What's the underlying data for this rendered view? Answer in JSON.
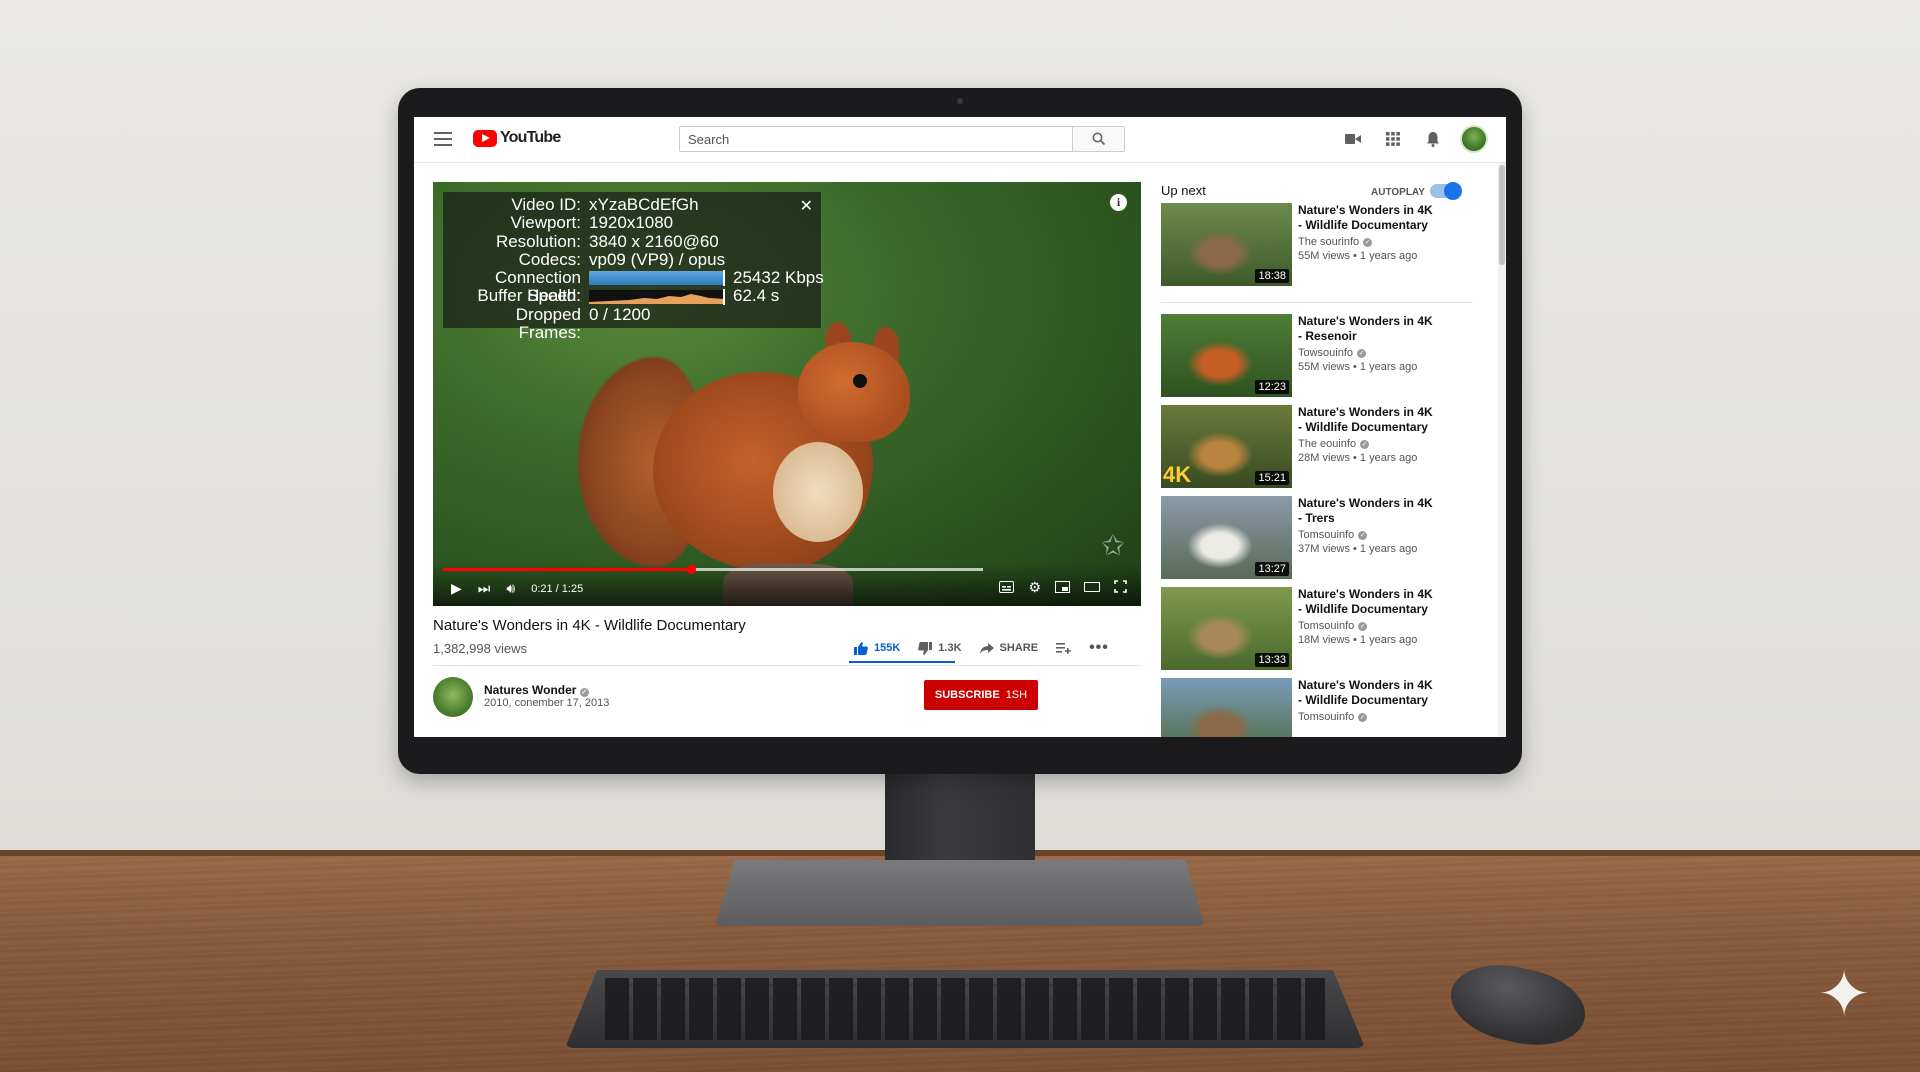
{
  "header": {
    "logo_text": "YouTube",
    "search_placeholder": "Search",
    "icons": [
      "menu-icon",
      "search-icon",
      "video-camera-icon",
      "apps-grid-icon",
      "bell-icon",
      "avatar"
    ]
  },
  "player": {
    "stats": [
      {
        "key": "Video ID:",
        "value": "xYzaBCdEfGh"
      },
      {
        "key": "Viewport:",
        "value": "1920x1080"
      },
      {
        "key": "Resolution:",
        "value": "3840 x 2160@60"
      },
      {
        "key": "Codecs:",
        "value": "vp09 (VP9) / opus"
      },
      {
        "key": "Connection Speed:",
        "value": "25432 Kbps"
      },
      {
        "key": "Buffer Health:",
        "value": "62.4 s"
      },
      {
        "key": "Dropped Frames:",
        "value": "0 / 1200"
      }
    ],
    "time": "0:21 / 1:25",
    "progress_played_fraction": 0.46,
    "progress_buffered_fraction": 1.0,
    "close_symbol": "✕",
    "info_symbol": "i"
  },
  "video": {
    "title": "Nature's Wonders in 4K - Wildlife Documentary",
    "views": "1,382,998 views",
    "like_count": "155K",
    "dislike_count": "1.3K",
    "share_label": "SHARE"
  },
  "channel": {
    "name": "Natures Wonder",
    "date": "2010, conember 17, 2013",
    "subscribe_label": "SUBSCRIBE",
    "subscribe_count": "1SH"
  },
  "sidebar": {
    "up_next_label": "Up next",
    "autoplay_label": "AUTOPLAY",
    "autoplay_on": true,
    "items": [
      {
        "title": "Nature's Wonders in 4K - Wildlife Documentary",
        "channel": "The sourinfo",
        "stats": "55M views • 1 years ago",
        "duration": "18:38",
        "colors": [
          "#6d8a4b",
          "#8a6a48",
          "#3e5a2c"
        ]
      },
      {
        "title": "Nature's Wonders in 4K - Resenoir",
        "channel": "Towsouinfo",
        "stats": "55M views • 1 years ago",
        "duration": "12:23",
        "colors": [
          "#4f7d35",
          "#c65e25",
          "#2e5220"
        ]
      },
      {
        "title": "Nature's Wonders in 4K - Wildlife Documentary",
        "channel": "The eouinfo",
        "stats": "28M views • 1 years ago",
        "duration": "15:21",
        "colors": [
          "#6a7a3a",
          "#b8843e",
          "#3a4a22"
        ],
        "badge": "4K"
      },
      {
        "title": "Nature's Wonders in 4K - Trers",
        "channel": "Tomsouinfo",
        "stats": "37M views • 1 years ago",
        "duration": "13:27",
        "colors": [
          "#8a9aa8",
          "#eceae4",
          "#5a6a58"
        ]
      },
      {
        "title": "Nature's Wonders in 4K - Wildlife Documentary",
        "channel": "Tomsouinfo",
        "stats": "18M views • 1 years ago",
        "duration": "13:33",
        "colors": [
          "#7f9a4e",
          "#a88a5a",
          "#4a6a2c"
        ]
      },
      {
        "title": "Nature's Wonders in 4K - Wildlife Documentary",
        "channel": "Tomsouinfo",
        "stats": "",
        "duration": "",
        "colors": [
          "#7a9ab8",
          "#8a6a48",
          "#4a6a3c"
        ]
      }
    ]
  },
  "colors": {
    "youtube_red": "#ff0000",
    "like_blue": "#065fd4",
    "subscribe_red": "#cc0000"
  }
}
